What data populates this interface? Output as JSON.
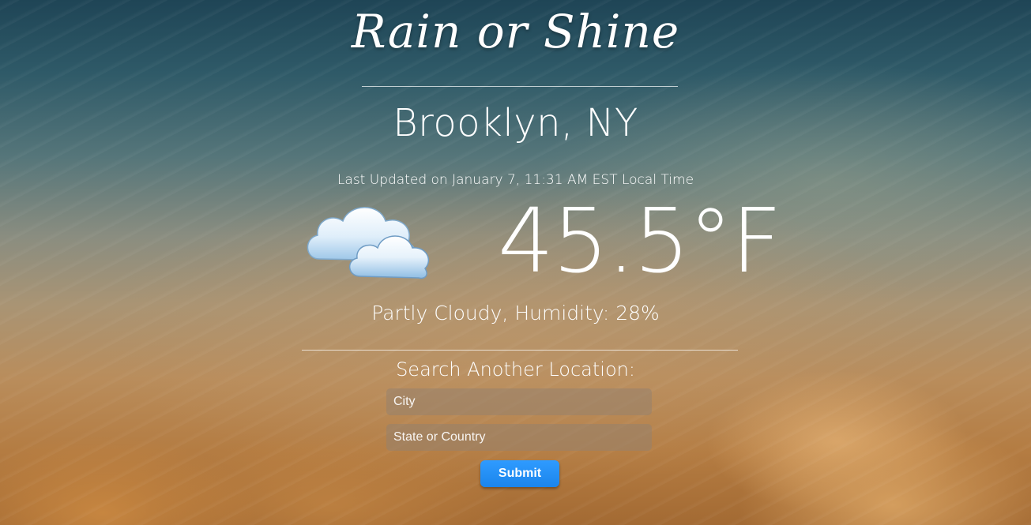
{
  "app": {
    "title": "Rain or Shine"
  },
  "weather": {
    "location": "Brooklyn, NY",
    "last_updated": "Last Updated on January 7, 11:31 AM EST Local Time",
    "icon": "partly-cloudy-icon",
    "temperature": "45.5°F",
    "conditions": "Partly Cloudy, Humidity: 28%"
  },
  "search": {
    "heading": "Search Another Location:",
    "city_placeholder": "City",
    "state_placeholder": "State or Country",
    "submit_label": "Submit"
  },
  "colors": {
    "accent": "#1e8cf4",
    "text": "#ffffff"
  }
}
